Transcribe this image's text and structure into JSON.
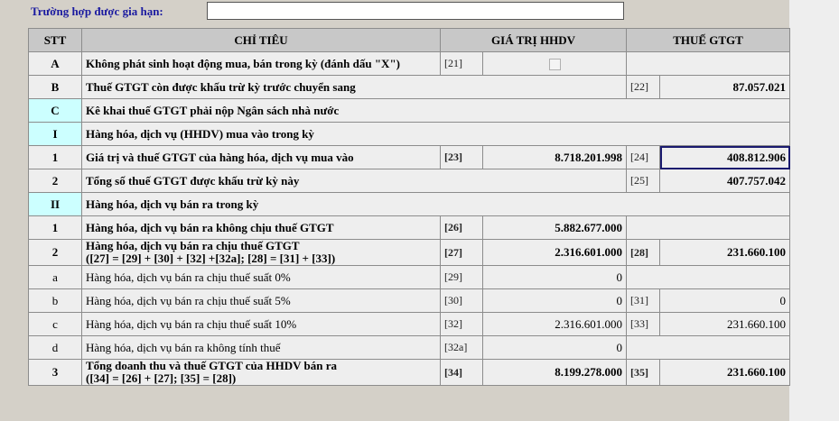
{
  "extension": {
    "label": "Trường hợp được gia hạn:",
    "value": ""
  },
  "headers": {
    "stt": "STT",
    "chi_tieu": "CHỈ TIÊU",
    "gia_tri": "GIÁ TRỊ HHDV",
    "thue": "THUẾ GTGT"
  },
  "rows": {
    "A": {
      "stt": "A",
      "label": "Không phát sinh hoạt động mua, bán trong kỳ (đánh dấu \"X\")",
      "code1": "[21]"
    },
    "B": {
      "stt": "B",
      "label": "Thuế GTGT còn được khấu trừ kỳ trước chuyển sang",
      "code2": "[22]",
      "val2": "87.057.021"
    },
    "C": {
      "stt": "C",
      "label": "Kê khai thuế GTGT phải nộp Ngân sách nhà nước"
    },
    "I": {
      "stt": "I",
      "label": "Hàng hóa, dịch vụ (HHDV) mua vào trong kỳ"
    },
    "I1": {
      "stt": "1",
      "label": "Giá trị và thuế GTGT của hàng hóa, dịch vụ mua vào",
      "code1": "[23]",
      "val1": "8.718.201.998",
      "code2": "[24]",
      "val2": "408.812.906"
    },
    "I2": {
      "stt": "2",
      "label": "Tổng số thuế GTGT  được khấu trừ kỳ này",
      "code2": "[25]",
      "val2": "407.757.042"
    },
    "II": {
      "stt": "II",
      "label": "Hàng hóa, dịch vụ bán ra trong kỳ"
    },
    "II1": {
      "stt": "1",
      "label": "Hàng hóa, dịch vụ bán ra không chịu thuế GTGT",
      "code1": "[26]",
      "val1": "5.882.677.000"
    },
    "II2": {
      "stt": "2",
      "label_l1": "Hàng hóa, dịch vụ bán ra chịu thuế GTGT",
      "label_l2": "([27] = [29] + [30] + [32] +[32a]; [28] = [31] + [33])",
      "code1": "[27]",
      "val1": "2.316.601.000",
      "code2": "[28]",
      "val2": "231.660.100"
    },
    "a": {
      "stt": "a",
      "label": "Hàng hóa, dịch vụ bán ra chịu thuế suất 0%",
      "code1": "[29]",
      "val1": "0"
    },
    "b": {
      "stt": "b",
      "label": "Hàng hóa, dịch vụ bán ra chịu thuế suất 5%",
      "code1": "[30]",
      "val1": "0",
      "code2": "[31]",
      "val2": "0"
    },
    "c": {
      "stt": "c",
      "label": "Hàng hóa, dịch vụ bán ra chịu thuế suất 10%",
      "code1": "[32]",
      "val1": "2.316.601.000",
      "code2": "[33]",
      "val2": "231.660.100"
    },
    "d": {
      "stt": "d",
      "label": "Hàng hóa, dịch vụ bán ra không tính thuế",
      "code1": "[32a]",
      "val1": "0"
    },
    "III3": {
      "stt": "3",
      "label_l1": "Tổng doanh thu và thuế GTGT của HHDV bán   ra",
      "label_l2": "([34] = [26]  +  [27]; [35] = [28])",
      "code1": "[34]",
      "val1": "8.199.278.000",
      "code2": "[35]",
      "val2": "231.660.100"
    }
  }
}
